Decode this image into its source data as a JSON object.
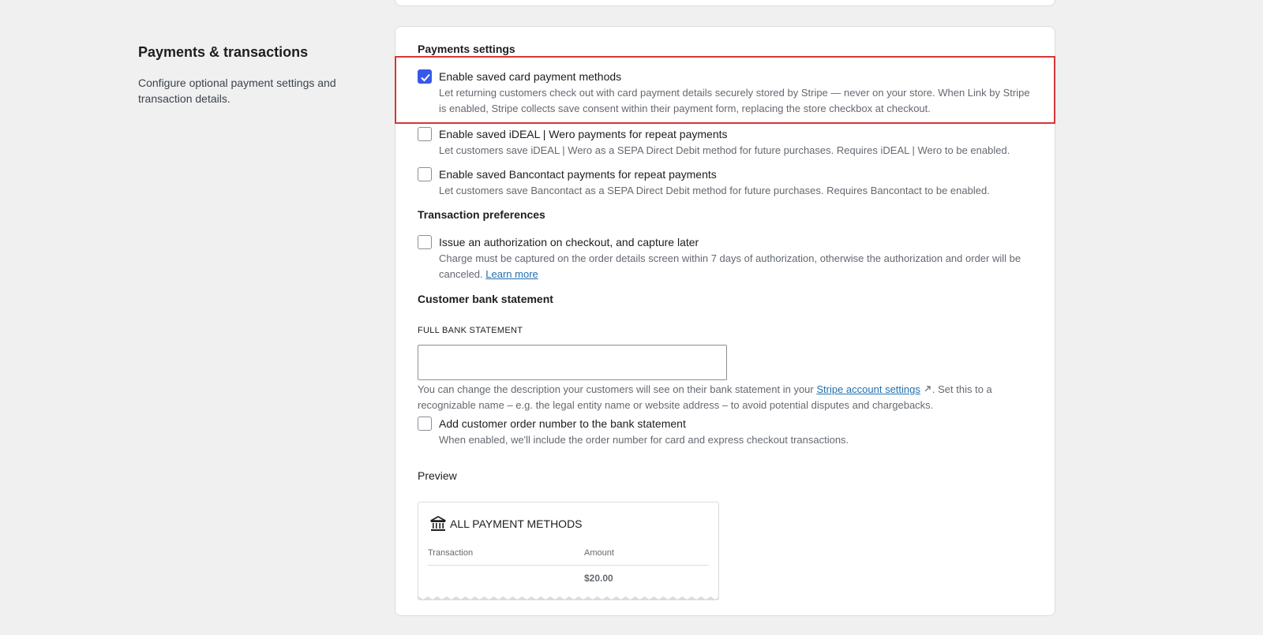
{
  "section": {
    "title": "Payments & transactions",
    "description": "Configure optional payment settings and transaction details."
  },
  "payments_settings": {
    "heading": "Payments settings",
    "options": [
      {
        "label": "Enable saved card payment methods",
        "description": "Let returning customers check out with card payment details securely stored by Stripe — never on your store. When Link by Stripe is enabled, Stripe collects save consent within their payment form, replacing the store checkbox at checkout.",
        "checked": true
      },
      {
        "label": "Enable saved iDEAL | Wero payments for repeat payments",
        "description": "Let customers save iDEAL | Wero as a SEPA Direct Debit method for future purchases. Requires iDEAL | Wero to be enabled.",
        "checked": false
      },
      {
        "label": "Enable saved Bancontact payments for repeat payments",
        "description": "Let customers save Bancontact as a SEPA Direct Debit method for future purchases. Requires Bancontact to be enabled.",
        "checked": false
      }
    ]
  },
  "transaction_preferences": {
    "heading": "Transaction preferences",
    "option": {
      "label": "Issue an authorization on checkout, and capture later",
      "description": "Charge must be captured on the order details screen within 7 days of authorization, otherwise the authorization and order will be canceled.",
      "link": "Learn more",
      "checked": false
    }
  },
  "bank_statement": {
    "heading": "Customer bank statement",
    "field_label": "FULL BANK STATEMENT",
    "value": "",
    "help_before": "You can change the description your customers will see on their bank statement in your ",
    "help_link": "Stripe account settings",
    "help_after": ". Set this to a recognizable name – e.g. the legal entity name or website address – to avoid potential disputes and chargebacks.",
    "order_option": {
      "label": "Add customer order number to the bank statement",
      "description": "When enabled, we'll include the order number for card and express checkout transactions.",
      "checked": false
    }
  },
  "preview": {
    "heading": "Preview",
    "title": "ALL PAYMENT METHODS",
    "col_transaction": "Transaction",
    "col_amount": "Amount",
    "amount": "$20.00"
  },
  "colors": {
    "accent": "#3858e9",
    "highlight": "#d63638",
    "link": "#2271b1"
  },
  "icons": [
    "checkmark-icon",
    "bank-icon",
    "external-link-icon"
  ]
}
